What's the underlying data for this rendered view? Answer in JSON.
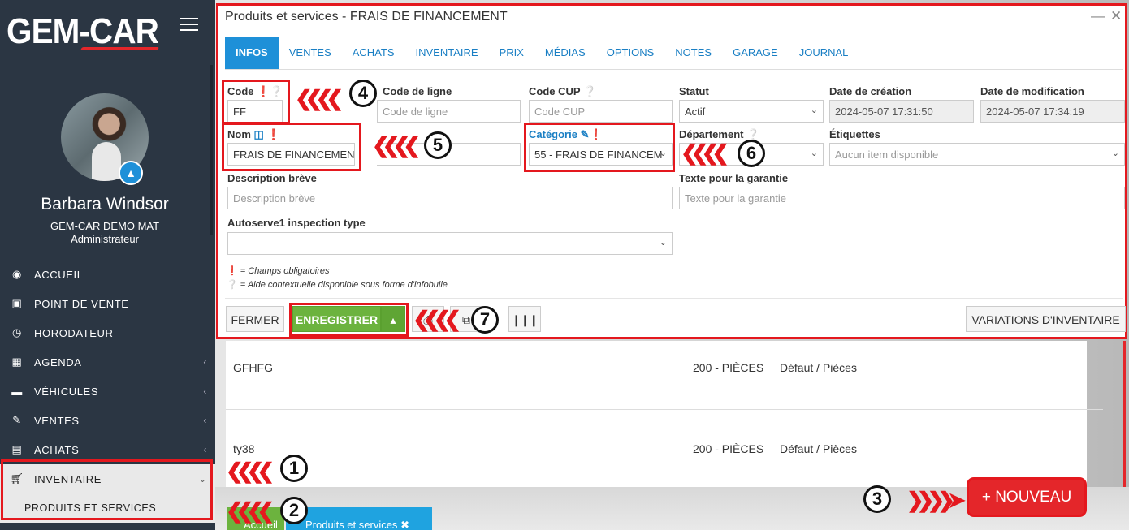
{
  "sidebar": {
    "logo": "GEM-CAR",
    "user_name": "Barbara Windsor",
    "user_company": "GEM-CAR DEMO MAT",
    "user_role": "Administrateur",
    "menu": [
      {
        "label": "ACCUEIL",
        "icon": "dashboard-icon"
      },
      {
        "label": "POINT DE VENTE",
        "icon": "cash-register-icon"
      },
      {
        "label": "HORODATEUR",
        "icon": "clock-icon"
      },
      {
        "label": "AGENDA",
        "icon": "calendar-icon"
      },
      {
        "label": "VÉHICULES",
        "icon": "car-icon"
      },
      {
        "label": "VENTES",
        "icon": "edit-icon"
      },
      {
        "label": "ACHATS",
        "icon": "credit-card-icon"
      },
      {
        "label": "INVENTAIRE",
        "icon": "cart-icon"
      }
    ],
    "submenu_label": "PRODUITS ET SERVICES"
  },
  "modal": {
    "title": "Produits et services - FRAIS DE FINANCEMENT",
    "minimize": "—",
    "close": "✕",
    "tabs": [
      "INFOS",
      "VENTES",
      "ACHATS",
      "INVENTAIRE",
      "PRIX",
      "MÉDIAS",
      "OPTIONS",
      "NOTES",
      "GARAGE",
      "JOURNAL"
    ],
    "fields": {
      "code_label": "Code",
      "code_value": "FF",
      "code_ligne_label": "Code de ligne",
      "code_ligne_placeholder": "Code de ligne",
      "code_cup_label": "Code CUP",
      "code_cup_placeholder": "Code CUP",
      "statut_label": "Statut",
      "statut_value": "Actif",
      "date_creation_label": "Date de création",
      "date_creation_value": "2024-05-07 17:31:50",
      "date_modif_label": "Date de modification",
      "date_modif_value": "2024-05-07 17:34:19",
      "nom_label": "Nom",
      "nom_value": "FRAIS DE FINANCEMENT",
      "categorie_label": "Catégorie",
      "categorie_value": "55 - FRAIS DE FINANCEM",
      "departement_label": "Département",
      "etiquettes_label": "Étiquettes",
      "etiquettes_placeholder": "Aucun item disponible",
      "desc_label": "Description brève",
      "desc_placeholder": "Description brève",
      "garantie_label": "Texte pour la garantie",
      "garantie_placeholder": "Texte pour la garantie",
      "autoserve_label": "Autoserve1 inspection type"
    },
    "legend_required": "= Champs obligatoires",
    "legend_help": "= Aide contextuelle disponible sous forme d'infobulle",
    "buttons": {
      "fermer": "FERMER",
      "enregistrer": "ENREGISTRER",
      "variations": "VARIATIONS D'INVENTAIRE"
    }
  },
  "list": {
    "rows": [
      {
        "name": "GFHFG",
        "category": "200 - PIÈCES",
        "dept": "Défaut / Pièces"
      },
      {
        "name": "ty38",
        "category": "200 - PIÈCES",
        "dept": "Défaut / Pièces"
      }
    ],
    "nouveau_label": "+ NOUVEAU",
    "bottom_tab_1": "Accueil",
    "bottom_tab_2": "Produits et services"
  },
  "callouts": [
    "1",
    "2",
    "3",
    "4",
    "5",
    "6",
    "7"
  ],
  "colors": {
    "sidebar_bg": "#2b3643",
    "accent_blue": "#1e90d8",
    "save_green": "#6cb33e",
    "highlight_red": "#e4181e"
  }
}
